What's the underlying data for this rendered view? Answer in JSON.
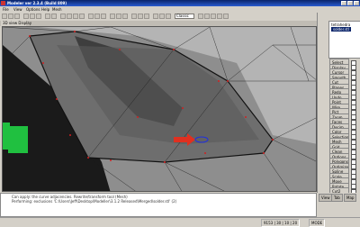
{
  "window": {
    "title": "Modeler ver 2.3.4 (Build 809)",
    "icon": "app-icon"
  },
  "menu": [
    "File",
    "View",
    "Options",
    "Help",
    "Mesh"
  ],
  "toolbar": {
    "view_select": "Classic"
  },
  "view": {
    "tab_label": "3D view  Display"
  },
  "tree": {
    "items": [
      "tetrahedra",
      "solder.stl"
    ]
  },
  "side_buttons": [
    "Select",
    "Display",
    "Cursor",
    "Smooth",
    "Cut",
    "Planes",
    "Redo",
    "Undo",
    "Point",
    "Wire",
    "Pict",
    "Zoom",
    "Faces",
    "Decim.",
    "Color",
    "Selection",
    "Mesh",
    "Grid",
    "Clean",
    "Options",
    "Polygons",
    "Optimize",
    "Spline",
    "Scale",
    "Move",
    "Rotate",
    "Cut2"
  ],
  "side_tabs": [
    "View",
    "Tab",
    "Map"
  ],
  "console": {
    "lines": [
      "Can apply: the curve adjacencies. Rewrite/transform tool (Mesh)",
      "Performing: exclusions 'C:\\Users\\Jeff\\Desktop\\Modeller\\3.1.2 Released\\Merged\\solder.stl' (2)"
    ]
  },
  "status": {
    "position": "9153 | 30 | 10 | 20",
    "zoom": "MODE"
  },
  "colors": {
    "titlebar": "#0a246a",
    "mesh": "#c4c4c4",
    "highlight_arrow": "#e03020",
    "green_block": "#20c040"
  }
}
